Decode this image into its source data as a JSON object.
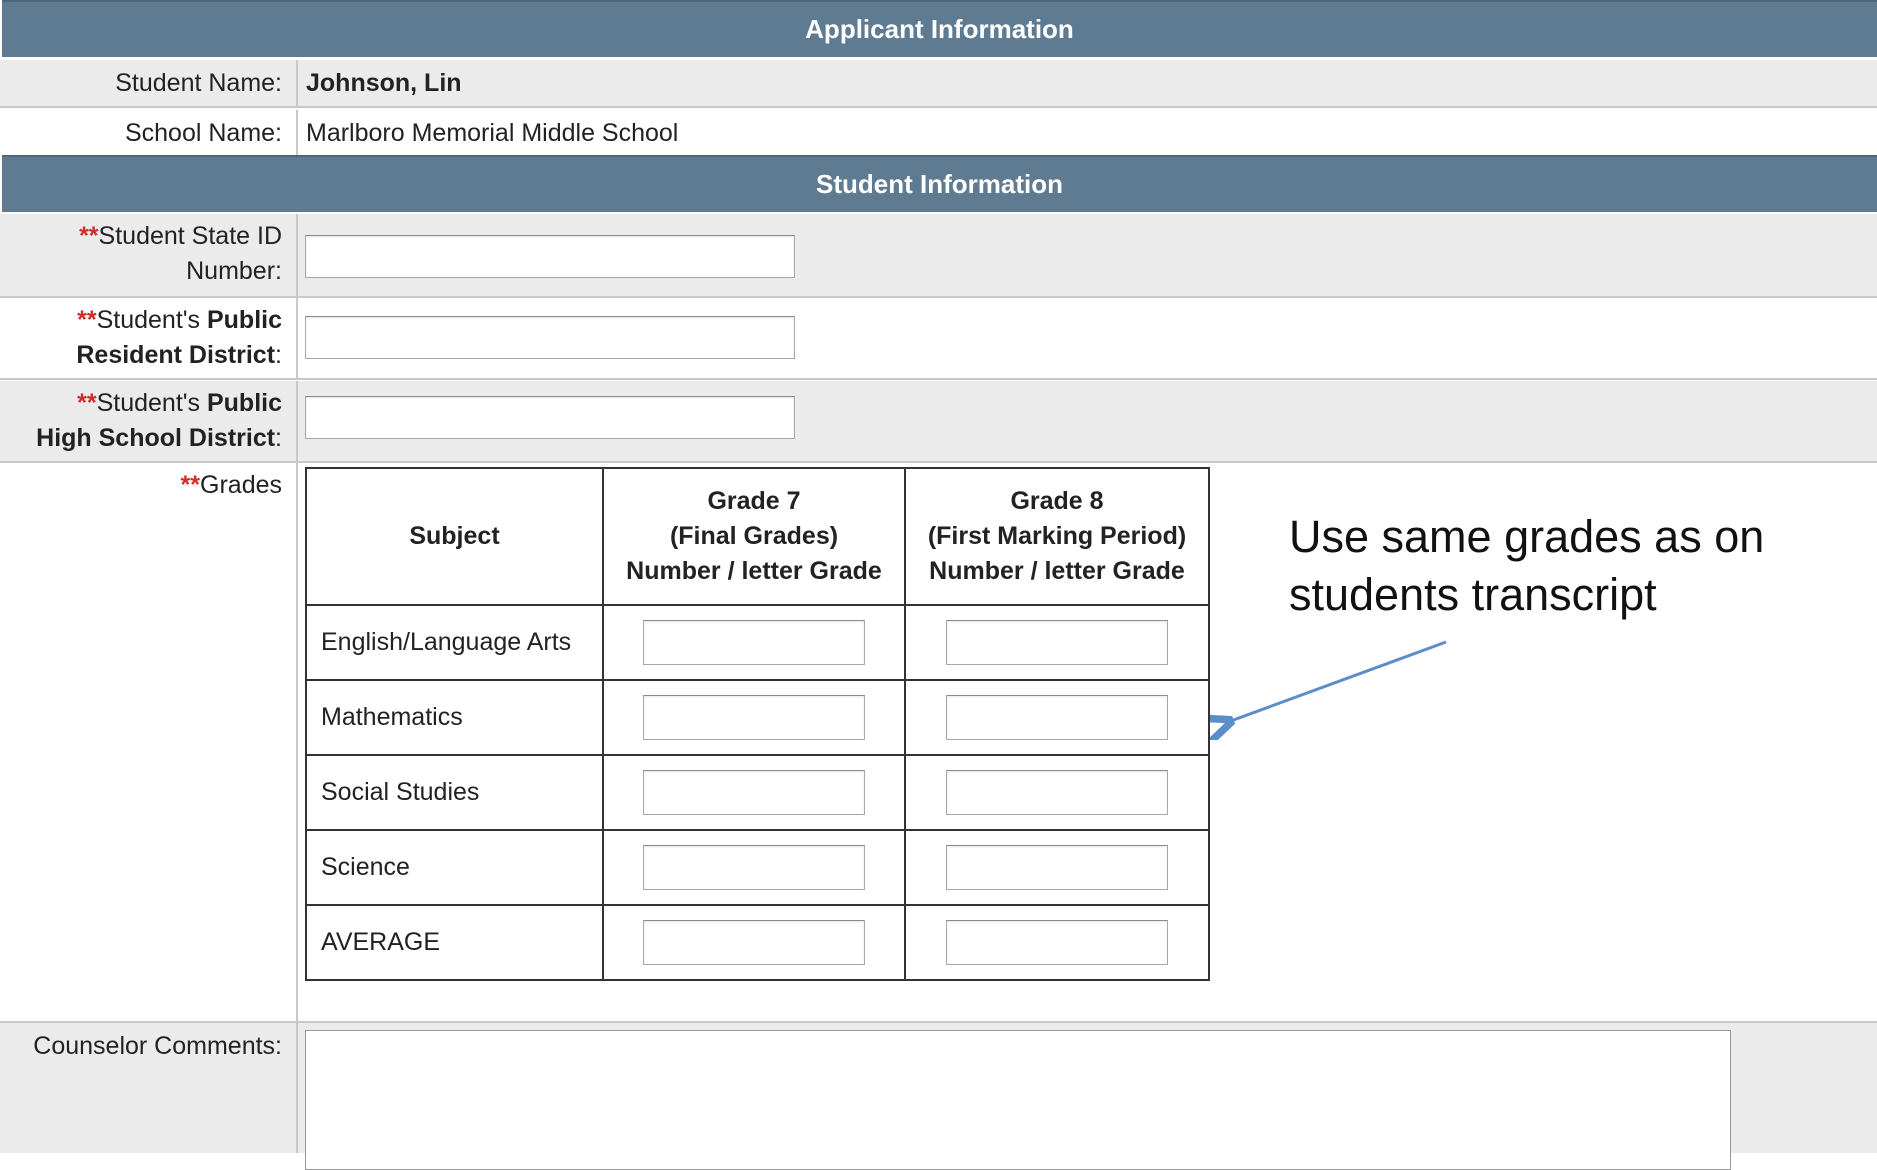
{
  "applicant_section": {
    "title": "Applicant Information",
    "student_name_label": "Student Name:",
    "student_name_value": "Johnson, Lin",
    "school_name_label": "School Name:",
    "school_name_value": "Marlboro Memorial Middle School"
  },
  "student_section": {
    "title": "Student Information",
    "required_marker": "**",
    "state_id": {
      "label_line1": "Student State ID",
      "label_line2": "Number:",
      "value": ""
    },
    "resident_district": {
      "label_prefix": "Student's ",
      "label_bold1": "Public",
      "label_bold2": "Resident District",
      "label_suffix": ":",
      "value": ""
    },
    "high_school_district": {
      "label_prefix": "Student's ",
      "label_bold1": "Public",
      "label_bold2": "High School District",
      "label_suffix": ":",
      "value": ""
    },
    "grades_label": "Grades",
    "grades_table": {
      "headers": {
        "subject": "Subject",
        "grade7": [
          "Grade 7",
          "(Final Grades)",
          "Number / letter Grade"
        ],
        "grade8": [
          "Grade 8",
          "(First Marking Period)",
          "Number / letter Grade"
        ]
      },
      "rows": [
        {
          "subject": "English/Language Arts",
          "grade7": "",
          "grade8": ""
        },
        {
          "subject": "Mathematics",
          "grade7": "",
          "grade8": ""
        },
        {
          "subject": "Social Studies",
          "grade7": "",
          "grade8": ""
        },
        {
          "subject": "Science",
          "grade7": "",
          "grade8": ""
        },
        {
          "subject": "AVERAGE",
          "grade7": "",
          "grade8": ""
        }
      ]
    },
    "counselor_comments_label": "Counselor Comments:",
    "counselor_comments_value": ""
  },
  "annotation": {
    "text_line1": "Use same grades as on",
    "text_line2": "students transcript",
    "arrow_color": "#5b8ec9"
  },
  "colors": {
    "header_bg": "#5f7b92",
    "row_gray": "#ebebeb",
    "required_red": "#d42a2a"
  }
}
